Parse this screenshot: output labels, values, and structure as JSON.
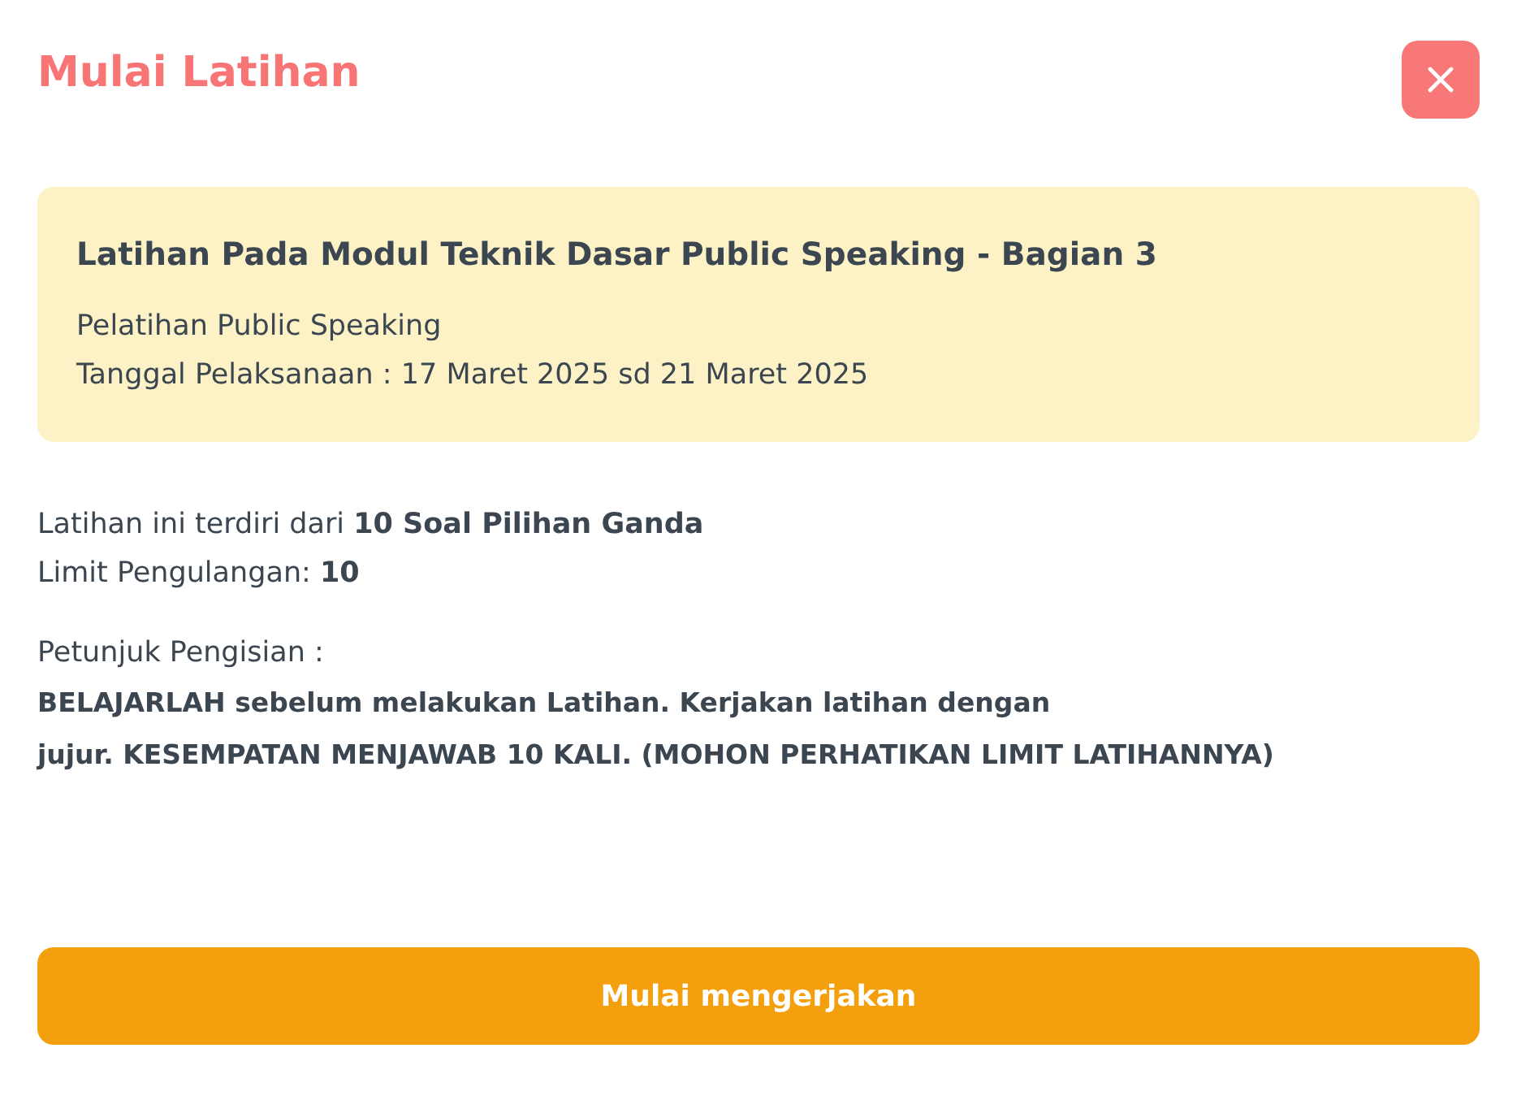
{
  "dialog": {
    "title": "Mulai Latihan"
  },
  "info_card": {
    "heading": "Latihan Pada Modul Teknik Dasar Public Speaking - Bagian 3",
    "lines": [
      "Pelatihan Public Speaking",
      "Tanggal Pelaksanaan : 17 Maret 2025 sd 21 Maret 2025"
    ]
  },
  "details": [
    "Latihan ini terdiri dari **10 Soal Pilihan Ganda**",
    "Limit Pengulangan: **10**"
  ],
  "instructions": {
    "label": "Petunjuk Pengisian :",
    "text": "BELAJARLAH sebelum melakukan Latihan. Kerjakan latihan dengan\njujur. KESEMPATAN MENJAWAB 10 KALI. (MOHON PERHATIKAN LIMIT LATIHANNYA)"
  },
  "start_button": {
    "label": "Mulai mengerjakan"
  }
}
